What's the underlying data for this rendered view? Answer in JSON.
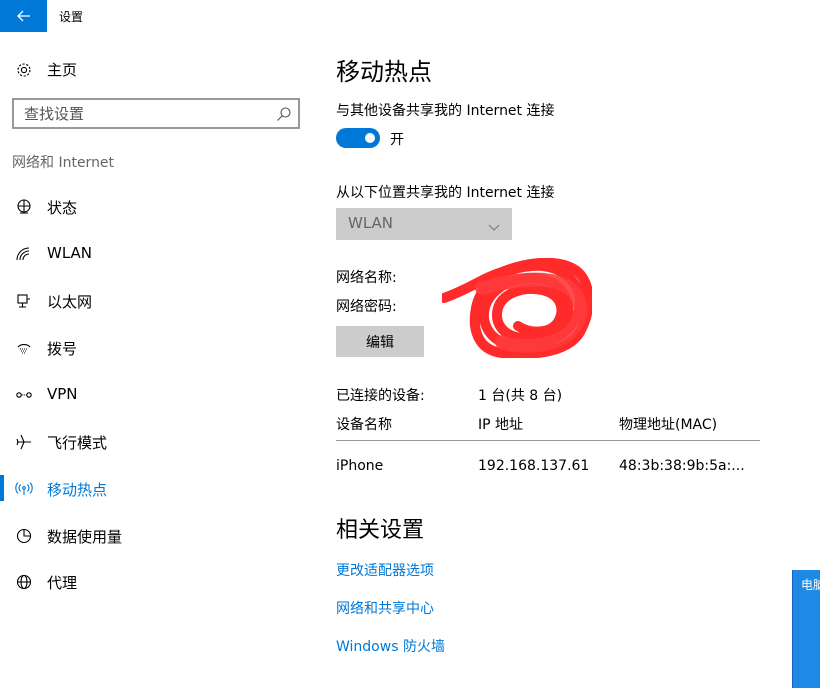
{
  "window": {
    "title": "设置",
    "back_icon": "back-arrow-icon",
    "accent_color": "#0078d7"
  },
  "sidebar": {
    "home_label": "主页",
    "search_placeholder": "查找设置",
    "section_label": "网络和 Internet",
    "items": [
      {
        "label": "状态",
        "icon": "globe-status-icon",
        "active": false
      },
      {
        "label": "WLAN",
        "icon": "wifi-icon",
        "active": false
      },
      {
        "label": "以太网",
        "icon": "ethernet-icon",
        "active": false
      },
      {
        "label": "拨号",
        "icon": "dialup-icon",
        "active": false
      },
      {
        "label": "VPN",
        "icon": "vpn-icon",
        "active": false
      },
      {
        "label": "飞行模式",
        "icon": "airplane-icon",
        "active": false
      },
      {
        "label": "移动热点",
        "icon": "hotspot-icon",
        "active": true
      },
      {
        "label": "数据使用量",
        "icon": "data-usage-icon",
        "active": false
      },
      {
        "label": "代理",
        "icon": "proxy-globe-icon",
        "active": false
      }
    ]
  },
  "main": {
    "title": "移动热点",
    "share_label": "与其他设备共享我的 Internet 连接",
    "toggle_state": "开",
    "toggle_on": true,
    "from_label": "从以下位置共享我的 Internet 连接",
    "dropdown_value": "WLAN",
    "network_name_label": "网络名称:",
    "network_password_label": "网络密码:",
    "edit_button": "编辑",
    "connected_label": "已连接的设备:",
    "connected_count": "1 台(共 8 台)",
    "table": {
      "headers": [
        "设备名称",
        "IP 地址",
        "物理地址(MAC)"
      ],
      "rows": [
        [
          "iPhone",
          "192.168.137.61",
          "48:3b:38:9b:5a:..."
        ]
      ]
    },
    "related_title": "相关设置",
    "links": [
      "更改适配器选项",
      "网络和共享中心",
      "Windows 防火墙"
    ]
  },
  "side_panel": {
    "text": "电脑"
  }
}
